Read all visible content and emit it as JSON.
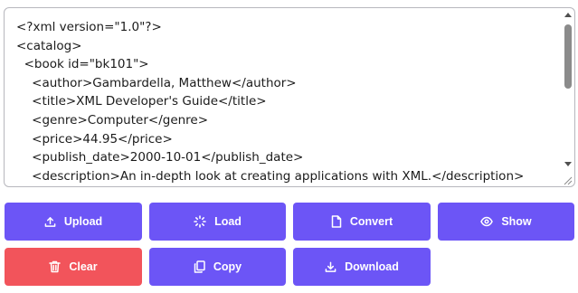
{
  "editor": {
    "lines": [
      "<?xml version=\"1.0\"?>",
      "<catalog>",
      "  <book id=\"bk101\">",
      "    <author>Gambardella, Matthew</author>",
      "    <title>XML Developer's Guide</title>",
      "    <genre>Computer</genre>",
      "    <price>44.95</price>",
      "    <publish_date>2000-10-01</publish_date>",
      "    <description>An in-depth look at creating applications with XML.</description>"
    ]
  },
  "buttons": {
    "upload": {
      "label": "Upload",
      "icon": "upload-icon"
    },
    "load": {
      "label": "Load",
      "icon": "loader-icon"
    },
    "convert": {
      "label": "Convert",
      "icon": "file-icon"
    },
    "show": {
      "label": "Show",
      "icon": "eye-icon"
    },
    "clear": {
      "label": "Clear",
      "icon": "trash-icon"
    },
    "copy": {
      "label": "Copy",
      "icon": "copy-icon"
    },
    "download": {
      "label": "Download",
      "icon": "download-icon"
    }
  },
  "colors": {
    "button_primary": "#6c55f6",
    "button_danger": "#f2545b"
  }
}
